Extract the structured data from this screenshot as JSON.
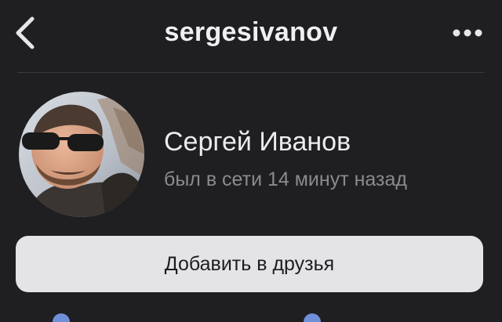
{
  "header": {
    "title": "sergesivanov",
    "back_icon": "chevron-left-icon",
    "more_icon": "more-horizontal-icon"
  },
  "profile": {
    "name": "Сергей Иванов",
    "status": "был в сети 14 минут назад",
    "avatar_icon": "user-avatar"
  },
  "actions": {
    "add_friend_label": "Добавить в друзья"
  },
  "colors": {
    "background": "#1f1f21",
    "button_bg": "#e4e4e6",
    "secondary_text": "#8a8a8f",
    "accent": "#6f8fd9"
  }
}
